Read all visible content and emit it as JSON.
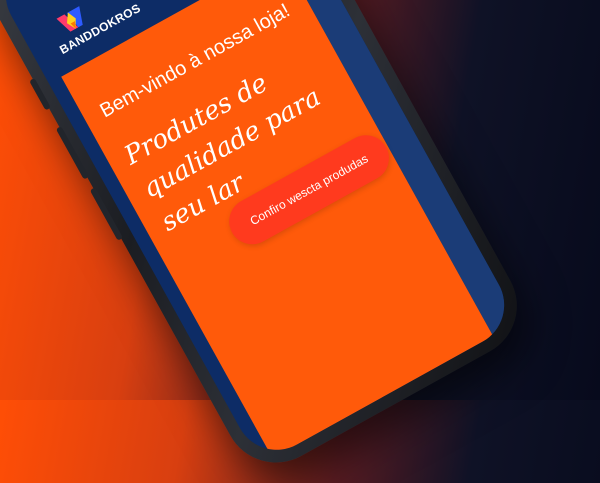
{
  "app": {
    "brand": "BANDDOKROS"
  },
  "hero": {
    "title": "Bem-vindo à nossa loja!",
    "subtitle": "Produtes de qualidade para seu lar",
    "cta_label": "Confiro wescta produdas"
  },
  "icons": {
    "menu": "hamburger-menu-icon",
    "logo": "brand-logo-icon"
  },
  "colors": {
    "background_left": "#ff4e06",
    "background_right": "#070a1c",
    "screen_header": "#0d2c66",
    "hero": "#ff5a0a",
    "cta": "#ff3a1e",
    "menu_icon": "#ff5a14"
  }
}
